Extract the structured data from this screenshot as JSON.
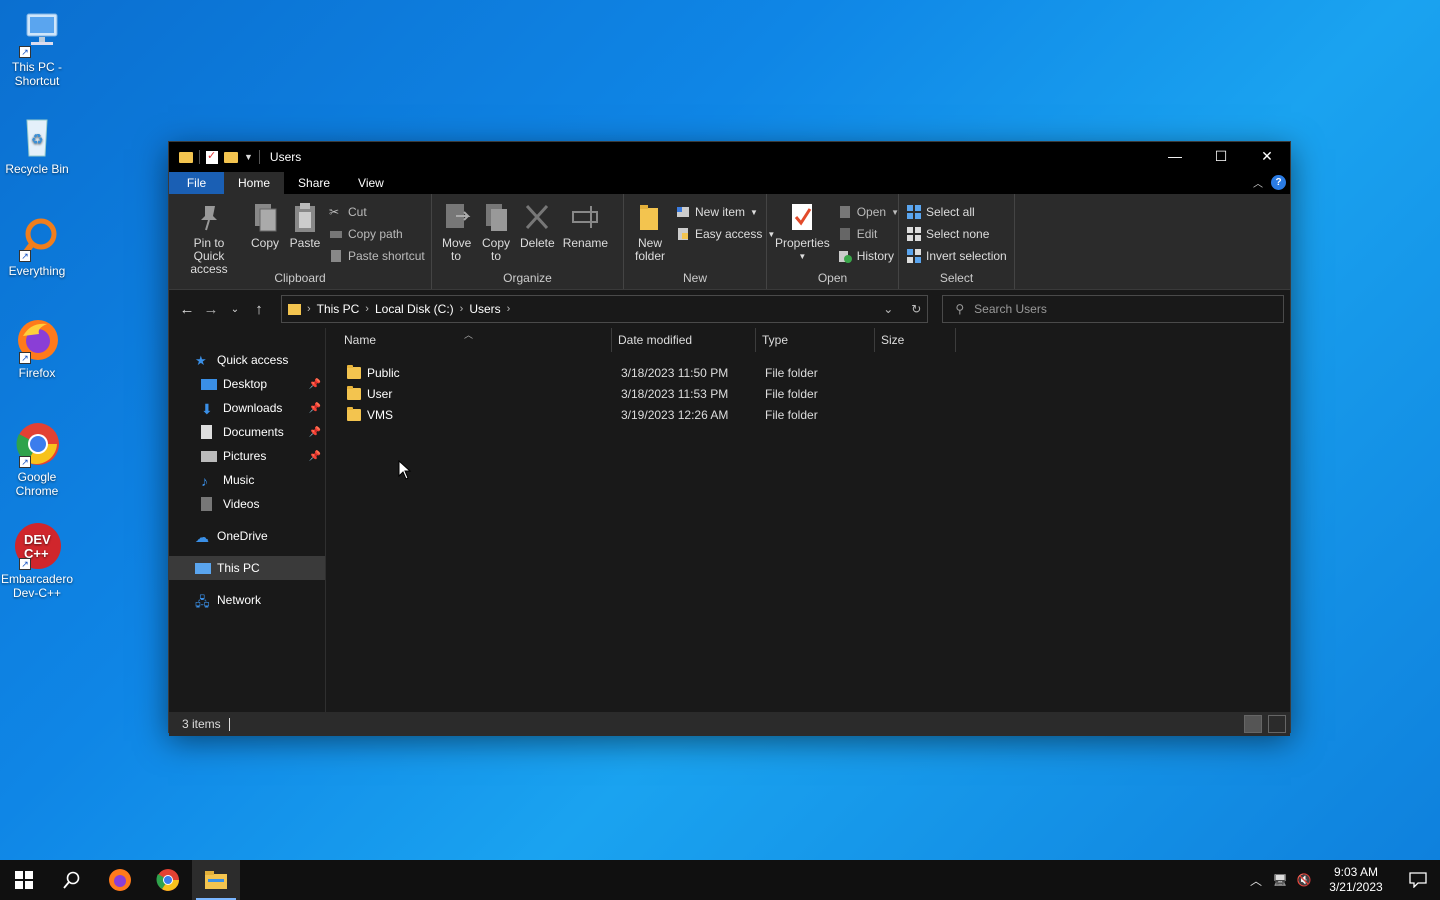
{
  "desktop": {
    "icons": [
      {
        "label": "This PC - Shortcut"
      },
      {
        "label": "Recycle Bin"
      },
      {
        "label": "Everything"
      },
      {
        "label": "Firefox"
      },
      {
        "label": "Google Chrome"
      },
      {
        "label": "Embarcadero Dev-C++"
      }
    ]
  },
  "window": {
    "title": "Users",
    "tabs": {
      "file": "File",
      "home": "Home",
      "share": "Share",
      "view": "View"
    },
    "ribbon": {
      "clipboard": {
        "label": "Clipboard",
        "pin": "Pin to Quick access",
        "copy": "Copy",
        "paste": "Paste",
        "cut": "Cut",
        "copy_path": "Copy path",
        "paste_shortcut": "Paste shortcut"
      },
      "organize": {
        "label": "Organize",
        "move_to": "Move to",
        "copy_to": "Copy to",
        "delete": "Delete",
        "rename": "Rename"
      },
      "new": {
        "label": "New",
        "new_folder": "New folder",
        "new_item": "New item",
        "easy_access": "Easy access"
      },
      "open": {
        "label": "Open",
        "properties": "Properties",
        "open": "Open",
        "edit": "Edit",
        "history": "History"
      },
      "select": {
        "label": "Select",
        "select_all": "Select all",
        "select_none": "Select none",
        "invert": "Invert selection"
      }
    },
    "address": {
      "crumbs": [
        "This PC",
        "Local Disk (C:)",
        "Users"
      ],
      "search_placeholder": "Search Users"
    },
    "nav": {
      "quick_access": "Quick access",
      "desktop": "Desktop",
      "downloads": "Downloads",
      "documents": "Documents",
      "pictures": "Pictures",
      "music": "Music",
      "videos": "Videos",
      "onedrive": "OneDrive",
      "this_pc": "This PC",
      "network": "Network"
    },
    "columns": {
      "name": "Name",
      "date": "Date modified",
      "type": "Type",
      "size": "Size"
    },
    "files": [
      {
        "name": "Public",
        "date": "3/18/2023 11:50 PM",
        "type": "File folder",
        "size": ""
      },
      {
        "name": "User",
        "date": "3/18/2023 11:53 PM",
        "type": "File folder",
        "size": ""
      },
      {
        "name": "VMS",
        "date": "3/19/2023 12:26 AM",
        "type": "File folder",
        "size": ""
      }
    ],
    "status": "3 items"
  },
  "taskbar": {
    "time": "9:03 AM",
    "date": "3/21/2023"
  },
  "colors": {
    "accent": "#1a5fb4",
    "folder": "#f3c44f",
    "desktop": "#0f86e6"
  }
}
